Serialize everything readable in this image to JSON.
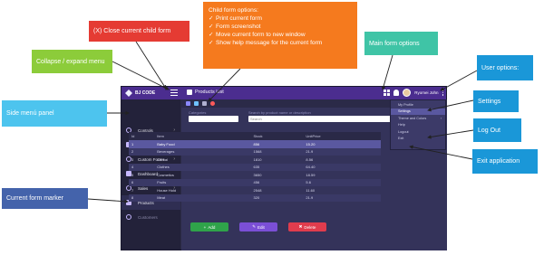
{
  "app": {
    "brand": "BJ CODE",
    "title": "Products List",
    "user_name": "Ryomei John",
    "sidebar": [
      {
        "label": "Controls",
        "has_chevron": true
      },
      {
        "label": "User Controls",
        "has_chevron": false
      },
      {
        "label": "Custom Forms",
        "has_chevron": true
      },
      {
        "label": "Dashboard",
        "has_chevron": false
      },
      {
        "label": "Sales",
        "has_chevron": true
      },
      {
        "label": "Products",
        "has_chevron": false
      },
      {
        "label": "Customers",
        "has_chevron": false
      }
    ],
    "filters": {
      "category_label": "Categories",
      "search_label": "Search by product name or description",
      "search_placeholder": "Search"
    },
    "table": {
      "headers": [
        "Id",
        "Item",
        "Stock",
        "UnitPrice"
      ],
      "rows": [
        [
          "1",
          "Baby Food",
          "856",
          "15.20"
        ],
        [
          "2",
          "Beverages",
          "1568",
          "21.9"
        ],
        [
          "3",
          "Cereal",
          "1810",
          "8.56"
        ],
        [
          "4",
          "Clothes",
          "635",
          "64.40"
        ],
        [
          "5",
          "Cosmetics",
          "3650",
          "18.59"
        ],
        [
          "6",
          "Fruits",
          "456",
          "5.6"
        ],
        [
          "7",
          "House Hold",
          "2548",
          "11.60"
        ],
        [
          "8",
          "Meat",
          "320",
          "21.9"
        ]
      ]
    },
    "buttons": {
      "add": "Add",
      "edit": "Edit",
      "delete": "Delete"
    },
    "user_menu": [
      {
        "label": "My Profile",
        "has_chevron": false
      },
      {
        "label": "Settings",
        "has_chevron": false
      },
      {
        "label": "Theme and Colors",
        "has_chevron": true
      },
      {
        "label": "Help",
        "has_chevron": false
      },
      {
        "label": "Logout",
        "has_chevron": false
      },
      {
        "label": "Exit",
        "has_chevron": false
      }
    ]
  },
  "callouts": {
    "close_child": "(X) Close current child form",
    "child_options_title": "Child form options:",
    "child_options": [
      "Print current form",
      "Form  screenshot",
      "Move current form to new window",
      "Show help message for the current form"
    ],
    "collapse": "Collapse / expand menu",
    "main_options": "Main form options",
    "user_options": "User options:",
    "side_panel": "Side menú panel",
    "current_marker": "Current form marker",
    "settings": "Settings",
    "logout": "Log Out",
    "exit": "Exit application"
  },
  "colors": {
    "red": "#e53b33",
    "orange": "#f57a1e",
    "green": "#8ccc3a",
    "teal": "#3fc4a6",
    "blue": "#1a97d8",
    "cyan": "#4dc4ee",
    "navy": "#4463ab",
    "add_button": "#2fa34a",
    "edit_button": "#7b4fd6",
    "delete_button": "#e03c4d"
  }
}
